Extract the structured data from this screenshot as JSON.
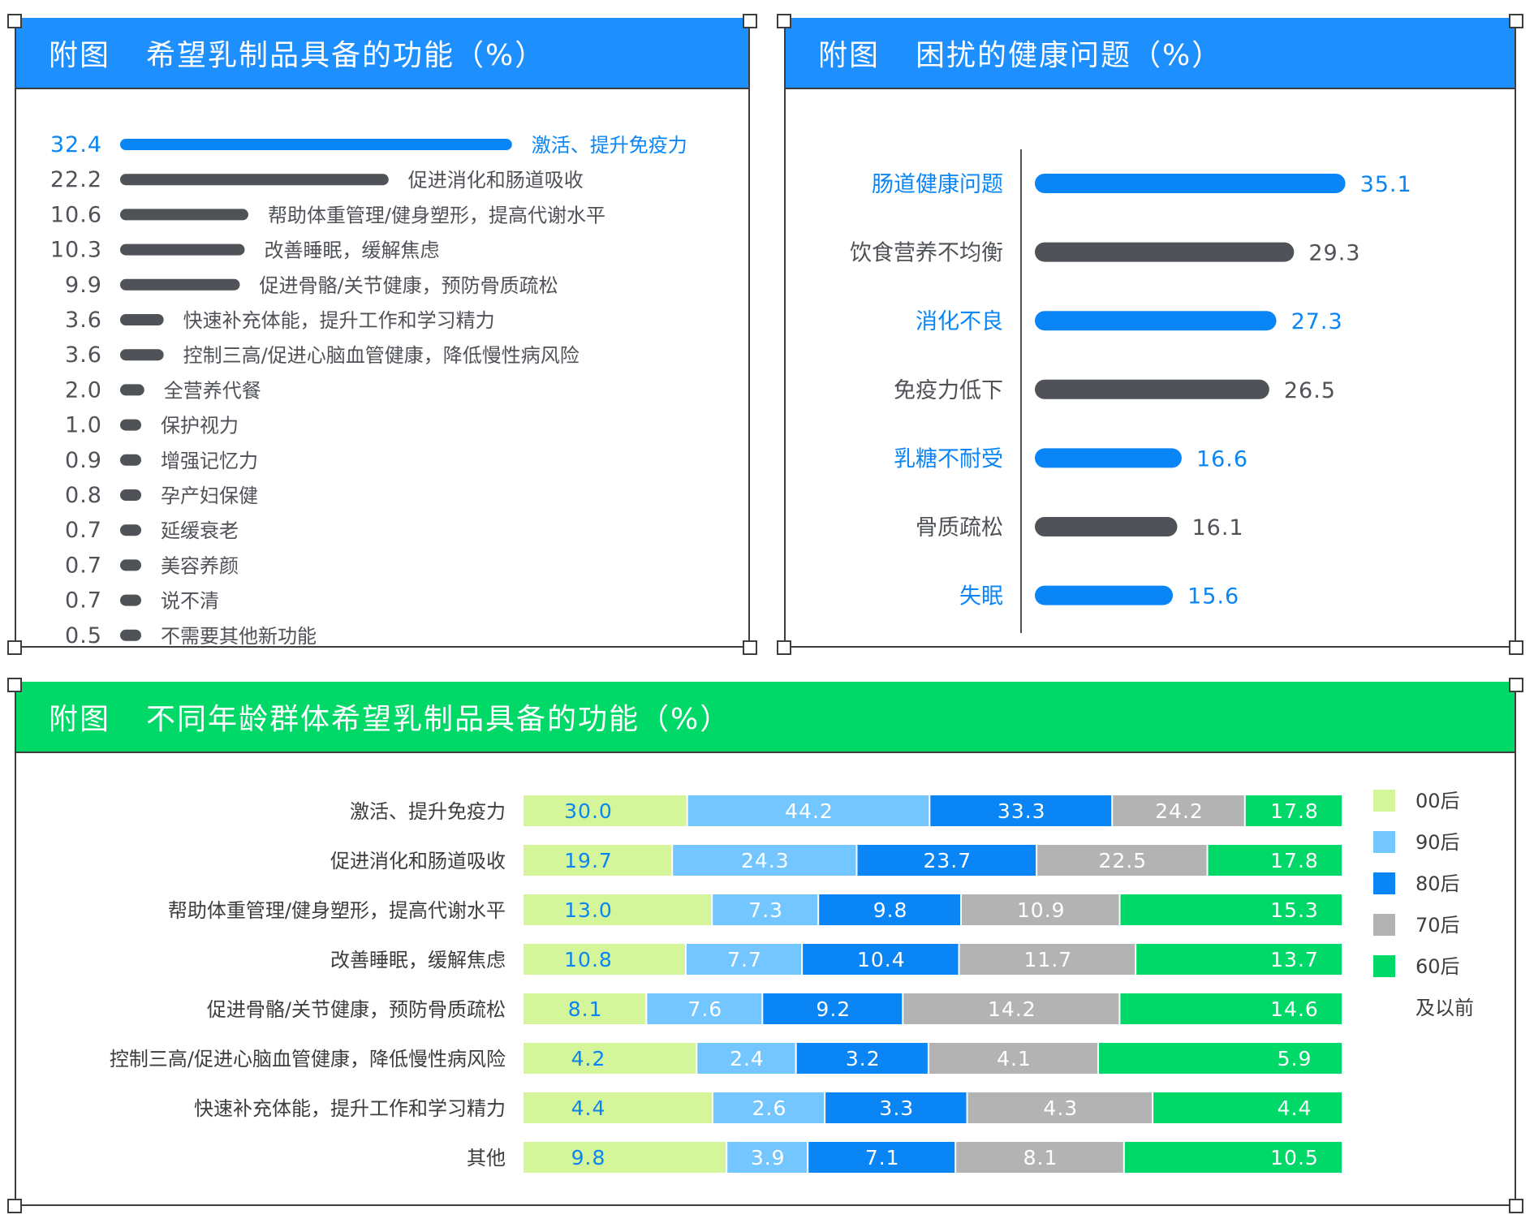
{
  "colors": {
    "blue_header": "#1e8fff",
    "green_header": "#00d968",
    "highlight": "#0a85f5",
    "dark_bar": "#4f5257",
    "age_series": [
      "#d5f59b",
      "#73c6ff",
      "#0a85f5",
      "#b3b3b3",
      "#00d968"
    ]
  },
  "panels": {
    "p1": {
      "prefix": "附图",
      "title": "希望乳制品具备的功能（%）"
    },
    "p2": {
      "prefix": "附图",
      "title": "困扰的健康问题（%）"
    },
    "p3": {
      "prefix": "附图",
      "title": "不同年龄群体希望乳制品具备的功能（%）"
    }
  },
  "chart_data": [
    {
      "type": "bar",
      "orientation": "horizontal",
      "categories": [
        "激活、提升免疫力",
        "促进消化和肠道吸收",
        "帮助体重管理/健身塑形，提高代谢水平",
        "改善睡眠，缓解焦虑",
        "促进骨骼/关节健康，预防骨质疏松",
        "快速补充体能，提升工作和学习精力",
        "控制三高/促进心脑血管健康，降低慢性病风险",
        "全营养代餐",
        "保护视力",
        "增强记忆力",
        "孕产妇保健",
        "延缓衰老",
        "美容养颜",
        "说不清",
        "不需要其他新功能"
      ],
      "values": [
        32.4,
        22.2,
        10.6,
        10.3,
        9.9,
        3.6,
        3.6,
        2.0,
        1.0,
        0.9,
        0.8,
        0.7,
        0.7,
        0.7,
        0.5
      ],
      "labels": [
        "32.4",
        "22.2",
        "10.6",
        "10.3",
        "9.9",
        "3.6",
        "3.6",
        "2.0",
        "1.0",
        "0.9",
        "0.8",
        "0.7",
        "0.7",
        "0.7",
        "0.5"
      ],
      "highlight_index": 0
    },
    {
      "type": "bar",
      "orientation": "horizontal",
      "categories": [
        "肠道健康问题",
        "饮食营养不均衡",
        "消化不良",
        "免疫力低下",
        "乳糖不耐受",
        "骨质疏松",
        "失眠"
      ],
      "values": [
        35.1,
        29.3,
        27.3,
        26.5,
        16.6,
        16.1,
        15.6
      ],
      "labels": [
        "35.1",
        "29.3",
        "27.3",
        "26.5",
        "16.6",
        "16.1",
        "15.6"
      ],
      "highlight": [
        true,
        false,
        true,
        false,
        true,
        false,
        true
      ]
    },
    {
      "type": "bar",
      "orientation": "horizontal",
      "stacked": true,
      "categories": [
        "激活、提升免疫力",
        "促进消化和肠道吸收",
        "帮助体重管理/健身塑形，提高代谢水平",
        "改善睡眠，缓解焦虑",
        "促进骨骼/关节健康，预防骨质疏松",
        "控制三高/促进心脑血管健康，降低慢性病风险",
        "快速补充体能，提升工作和学习精力",
        "其他"
      ],
      "series": [
        {
          "name": "00后",
          "values": [
            30.0,
            19.7,
            13.0,
            10.8,
            8.1,
            4.2,
            4.4,
            9.8
          ],
          "labels": [
            "30.0",
            "19.7",
            "13.0",
            "10.8",
            "8.1",
            "4.2",
            "4.4",
            "9.8"
          ]
        },
        {
          "name": "90后",
          "values": [
            44.2,
            24.3,
            7.3,
            7.7,
            7.6,
            2.4,
            2.6,
            3.9
          ],
          "labels": [
            "44.2",
            "24.3",
            "7.3",
            "7.7",
            "7.6",
            "2.4",
            "2.6",
            "3.9"
          ]
        },
        {
          "name": "80后",
          "values": [
            33.3,
            23.7,
            9.8,
            10.4,
            9.2,
            3.2,
            3.3,
            7.1
          ],
          "labels": [
            "33.3",
            "23.7",
            "9.8",
            "10.4",
            "9.2",
            "3.2",
            "3.3",
            "7.1"
          ]
        },
        {
          "name": "70后",
          "values": [
            24.2,
            22.5,
            10.9,
            11.7,
            14.2,
            4.1,
            4.3,
            8.1
          ],
          "labels": [
            "24.2",
            "22.5",
            "10.9",
            "11.7",
            "14.2",
            "4.1",
            "4.3",
            "8.1"
          ]
        },
        {
          "name": "60后及以前",
          "values": [
            17.8,
            17.8,
            15.3,
            13.7,
            14.6,
            5.9,
            4.4,
            10.5
          ],
          "labels": [
            "17.8",
            "17.8",
            "15.3",
            "13.7",
            "14.6",
            "5.9",
            "4.4",
            "10.5"
          ]
        }
      ],
      "legend": [
        "00后",
        "90后",
        "80后",
        "70后",
        "60后",
        "及以前"
      ],
      "legend_position": "right"
    }
  ]
}
